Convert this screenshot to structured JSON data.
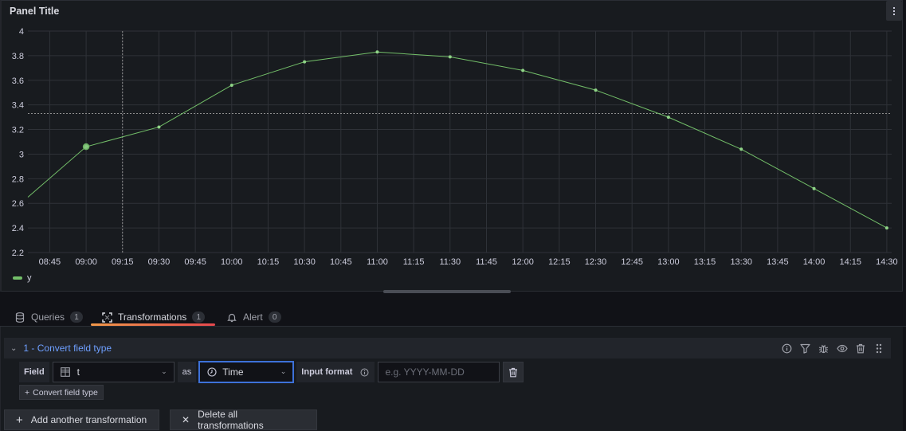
{
  "panel": {
    "title": "Panel Title",
    "menu_icon": "kebab-menu-icon"
  },
  "chart_data": {
    "type": "line",
    "title": "Panel Title",
    "xlabel": "",
    "ylabel": "",
    "series": [
      {
        "name": "y",
        "color": "#73bf69",
        "x": [
          "08:36",
          "09:00",
          "09:30",
          "10:00",
          "10:30",
          "11:00",
          "11:30",
          "12:00",
          "12:30",
          "13:00",
          "13:30",
          "14:00",
          "14:30"
        ],
        "values": [
          2.65,
          3.06,
          3.22,
          3.56,
          3.75,
          3.83,
          3.79,
          3.68,
          3.52,
          3.3,
          3.04,
          2.72,
          2.4
        ]
      }
    ],
    "x_ticks": [
      "08:45",
      "09:00",
      "09:15",
      "09:30",
      "09:45",
      "10:00",
      "10:15",
      "10:30",
      "10:45",
      "11:00",
      "11:15",
      "11:30",
      "11:45",
      "12:00",
      "12:15",
      "12:30",
      "12:45",
      "13:00",
      "13:15",
      "13:30",
      "13:45",
      "14:00",
      "14:15",
      "14:30"
    ],
    "y_ticks": [
      "4",
      "3.8",
      "3.6",
      "3.4",
      "3.2",
      "3",
      "2.8",
      "2.6",
      "2.4",
      "2.2"
    ],
    "ylim": [
      2.2,
      4.0
    ],
    "xlim": [
      "08:36",
      "14:32"
    ],
    "grid": true,
    "legend": "bottom-left",
    "crosshair": {
      "x": "09:15",
      "y": 3.33,
      "hover_point": "09:00"
    }
  },
  "tabs": [
    {
      "label": "Queries",
      "count": "1",
      "icon": "database-icon"
    },
    {
      "label": "Transformations",
      "count": "1",
      "icon": "transform-icon",
      "active": true
    },
    {
      "label": "Alert",
      "count": "0",
      "icon": "bell-icon"
    }
  ],
  "transformation": {
    "title": "1 - Convert field type",
    "actions": [
      "info-icon",
      "filter-icon",
      "bug-icon",
      "eye-icon",
      "trash-icon",
      "drag-handle-icon"
    ],
    "field_label": "Field",
    "field_value": "t",
    "as_label": "as",
    "type_value": "Time",
    "input_format_label": "Input format",
    "input_format_placeholder": "e.g. YYYY-MM-DD",
    "add_convert_label": "Convert field type"
  },
  "buttons": {
    "add_transformation": "Add another transformation",
    "delete_all": "Delete all transformations"
  },
  "accent": {
    "series": "#73bf69",
    "link": "#6e9fff",
    "focus": "#3d71d9",
    "tab_underline_start": "#f2994a",
    "tab_underline_end": "#e5484d"
  }
}
